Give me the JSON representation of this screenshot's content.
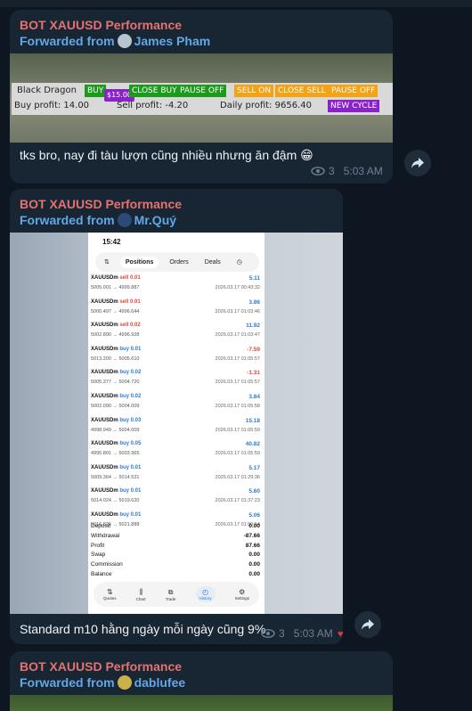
{
  "messages": [
    {
      "sender": "BOT XAUUSD Performance",
      "forwarded_prefix": "Forwarded from",
      "forwarded_name": "James Pham",
      "panel": {
        "name": "Black Dragon",
        "buy_btn": "BUY",
        "price_badge": "$15.00",
        "close_buy": "CLOSE BUY",
        "pause_off_1": "PAUSE OFF",
        "sell_on": "SELL ON",
        "close_sell": "CLOSE SELL",
        "pause_off_2": "PAUSE OFF",
        "buy_profit": "Buy profit: 14.00",
        "sell_profit": "Sell profit: -4.20",
        "daily_profit": "Daily profit: 9656.40",
        "new_cycle": "NEW CYCLE"
      },
      "text": "tks bro, nay đi tàu lượn cũng nhiều nhưng ăn đậm",
      "emoji": "😁",
      "views": "3",
      "time": "5:03 AM"
    },
    {
      "sender": "BOT XAUUSD Performance",
      "forwarded_prefix": "Forwarded from",
      "forwarded_name": "Mr.Quý",
      "phone": {
        "clock": "15:42",
        "tabs": [
          "Positions",
          "Orders",
          "Deals"
        ],
        "trades": [
          {
            "symbol": "XAUUSDm",
            "side": "sell 0.01",
            "dir": "sell",
            "price": "5005.001 → 4999.887",
            "profit": "5.11",
            "date": "2026.03.17 00:43:32"
          },
          {
            "symbol": "XAUUSDm",
            "side": "sell 0.01",
            "dir": "sell",
            "price": "5000.497 → 4996.644",
            "profit": "3.86",
            "date": "2026.03.17 01:03:46"
          },
          {
            "symbol": "XAUUSDm",
            "side": "sell 0.02",
            "dir": "sell",
            "price": "5002.890 → 4996.928",
            "profit": "11.92",
            "date": "2026.03.17 01:03:47"
          },
          {
            "symbol": "XAUUSDm",
            "side": "buy 0.01",
            "dir": "buy",
            "price": "5013.200 → 5005.610",
            "profit": "-7.59",
            "date": "2026.03.17 01:05:57"
          },
          {
            "symbol": "XAUUSDm",
            "side": "buy 0.02",
            "dir": "buy",
            "price": "5005.377 → 5004.720",
            "profit": "-1.31",
            "date": "2026.03.17 01:05:57"
          },
          {
            "symbol": "XAUUSDm",
            "side": "buy 0.02",
            "dir": "buy",
            "price": "5002.090 → 5004.009",
            "profit": "3.84",
            "date": "2026.03.17 01:05:58"
          },
          {
            "symbol": "XAUUSDm",
            "side": "buy 0.03",
            "dir": "buy",
            "price": "4998.949 → 5004.009",
            "profit": "15.18",
            "date": "2026.03.17 01:05:59"
          },
          {
            "symbol": "XAUUSDm",
            "side": "buy 0.05",
            "dir": "buy",
            "price": "4995.801 → 5003.965",
            "profit": "40.82",
            "date": "2026.03.17 01:05:59"
          },
          {
            "symbol": "XAUUSDm",
            "side": "buy 0.01",
            "dir": "buy",
            "price": "5009.364 → 5014.531",
            "profit": "5.17",
            "date": "2026.03.17 01:29:36"
          },
          {
            "symbol": "XAUUSDm",
            "side": "buy 0.01",
            "dir": "buy",
            "price": "5014.024 → 5019.620",
            "profit": "5.60",
            "date": "2026.03.17 01:37:23"
          },
          {
            "symbol": "XAUUSDm",
            "side": "buy 0.01",
            "dir": "buy",
            "price": "5016.826 → 5021.888",
            "profit": "5.06",
            "date": "2026.03.17 01:50:14"
          }
        ],
        "summary": [
          {
            "label": "Deposit",
            "value": "0.00"
          },
          {
            "label": "Withdrawal",
            "value": "-87.66"
          },
          {
            "label": "Profit",
            "value": "87.66"
          },
          {
            "label": "Swap",
            "value": "0.00"
          },
          {
            "label": "Commission",
            "value": "0.00"
          },
          {
            "label": "Balance",
            "value": "0.00"
          }
        ],
        "bottom_nav": [
          "Quotes",
          "Chart",
          "Trade",
          "History",
          "Settings"
        ]
      },
      "text": "Standard m10 hằng ngày mỗi ngày cũng 9%",
      "views": "3",
      "time": "5:03 AM"
    },
    {
      "sender": "BOT XAUUSD Performance",
      "forwarded_prefix": "Forwarded from",
      "forwarded_name": "dablufee"
    }
  ],
  "colors": {
    "background": "#0e1621",
    "bubble": "#182533",
    "sender": "#e5726f",
    "forward": "#62a7e8",
    "meta": "#6d8092"
  },
  "icons": [
    "eye-icon",
    "share-icon",
    "heart-icon",
    "avatar-icon"
  ]
}
